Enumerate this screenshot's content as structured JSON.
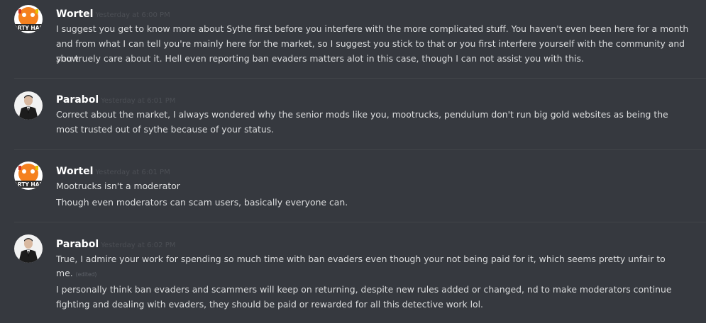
{
  "messages": [
    {
      "author": "Wortel",
      "timestamp": "Yesterday at 6:00 PM",
      "avatar": "wortel-avatar",
      "lines": [
        "I suggest you get to know more about Sythe first before you interfere with the more complicated stuff.  You haven't even been here for a month",
        "and from what I can tell you're mainly here for the market, so I suggest you stick to that or you first interfere yourself with the community and show",
        "you truely care about it. Hell even reporting ban evaders matters alot in this case, though I can not assist you with this."
      ]
    },
    {
      "author": "Parabol",
      "timestamp": "Yesterday at 6:01 PM",
      "avatar": "parabol-avatar",
      "lines": [
        "Correct about the market, I always wondered why the senior mods like you, mootrucks, pendulum don't run big gold websites as being the",
        "most trusted out of sythe because of your status."
      ]
    },
    {
      "author": "Wortel",
      "timestamp": "Yesterday at 6:01 PM",
      "avatar": "wortel-avatar",
      "lines": [
        "Mootrucks isn't a moderator",
        "Though even moderators can scam users, basically everyone can."
      ]
    },
    {
      "author": "Parabol",
      "timestamp": "Yesterday at 6:02 PM",
      "avatar": "parabol-avatar",
      "lines": [
        "True, I admire your work for spending so much time with ban evaders even though your not being paid for it, which seems pretty unfair to",
        "me.",
        "I personally think ban evaders and scammers will keep on returning, despite new rules added or changed, nd to make moderators continue",
        "fighting and dealing with evaders, they should be paid or rewarded for all this detective work lol."
      ],
      "edited_label": "(edited)"
    }
  ],
  "avatar_text": {
    "wortel": "ARTY HAP"
  },
  "colors": {
    "background": "#36393f",
    "username": "#ffffff",
    "message_text": "#dcddde",
    "timestamp": "#4c4f55",
    "divider": "#42454a",
    "wortel_avatar_orange": "#f5811f"
  }
}
